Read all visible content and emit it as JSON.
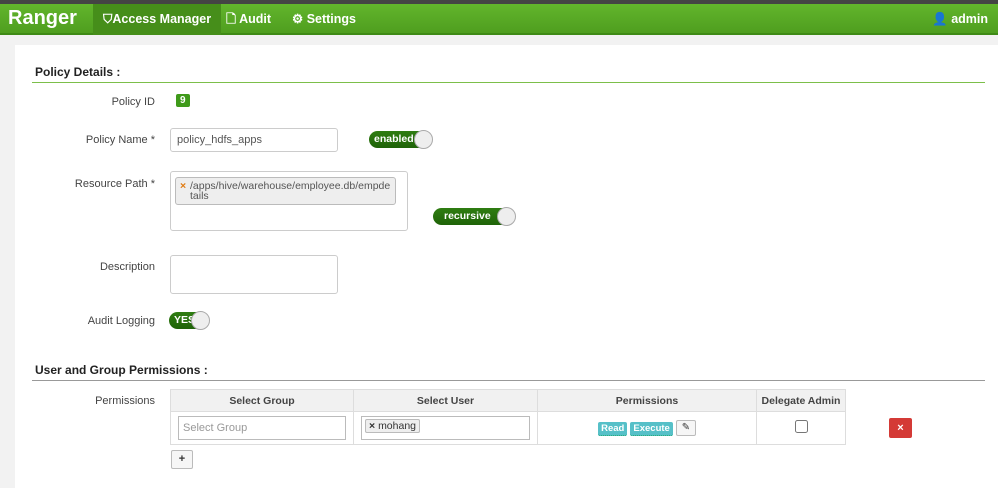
{
  "nav": {
    "brand": "Ranger",
    "items": [
      {
        "label": "Access Manager",
        "icon": "shield-icon"
      },
      {
        "label": "Audit",
        "icon": "file-icon"
      },
      {
        "label": "Settings",
        "icon": "gear-icon"
      }
    ],
    "user": "admin"
  },
  "policy": {
    "section": "Policy Details :",
    "id_label": "Policy ID",
    "id": "9",
    "name_label": "Policy Name *",
    "name": "policy_hdfs_apps",
    "enabled": "enabled",
    "path_label": "Resource Path *",
    "path": "/apps/hive/warehouse/employee.db/empdetails",
    "recursive": "recursive",
    "desc_label": "Description",
    "desc": "",
    "audit_label": "Audit Logging",
    "audit": "YES"
  },
  "perms": {
    "section": "User and Group Permissions :",
    "label": "Permissions",
    "headers": [
      "Select Group",
      "Select User",
      "Permissions",
      "Delegate Admin"
    ],
    "group_placeholder": "Select Group",
    "user": "mohang",
    "permissions": [
      "Read",
      "Execute"
    ],
    "delete": "×",
    "add": "+"
  }
}
